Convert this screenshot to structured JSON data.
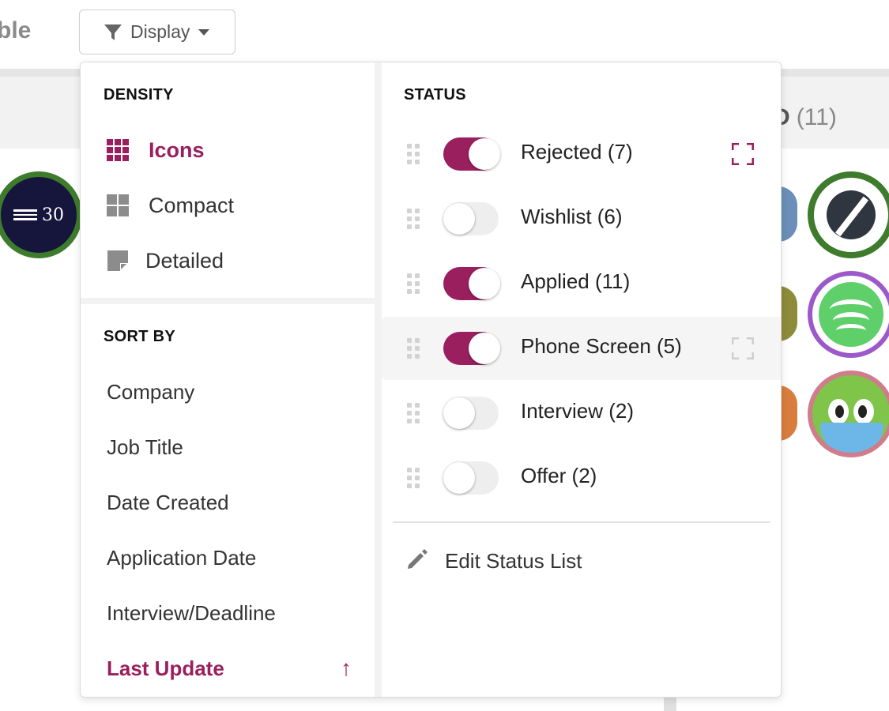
{
  "page": {
    "partial_title": "ble"
  },
  "toolbar": {
    "display_label": "Display"
  },
  "column": {
    "title_partial": "ED",
    "count": "(11)"
  },
  "logos": {
    "thirty_text": "30"
  },
  "colors": {
    "accent": "#9a1f5e",
    "toggle_off": "#eeeeee",
    "muted_icon": "#8c8c8c"
  },
  "density": {
    "heading": "DENSITY",
    "items": [
      {
        "label": "Icons",
        "icon": "grid-icon",
        "active": true
      },
      {
        "label": "Compact",
        "icon": "four-squares-icon",
        "active": false
      },
      {
        "label": "Detailed",
        "icon": "note-icon",
        "active": false
      }
    ]
  },
  "sort": {
    "heading": "SORT BY",
    "items": [
      {
        "label": "Company"
      },
      {
        "label": "Job Title"
      },
      {
        "label": "Date Created"
      },
      {
        "label": "Application Date"
      },
      {
        "label": "Interview/Deadline"
      },
      {
        "label": "Last Update",
        "active": true,
        "direction_icon": "arrow-up-icon",
        "direction_glyph": "↑"
      }
    ]
  },
  "status": {
    "heading": "STATUS",
    "items": [
      {
        "label": "Rejected (7)",
        "enabled": true,
        "expand_icon": true,
        "expand_active": true
      },
      {
        "label": "Wishlist (6)",
        "enabled": false
      },
      {
        "label": "Applied (11)",
        "enabled": true
      },
      {
        "label": "Phone Screen (5)",
        "enabled": true,
        "expand_icon": true,
        "expand_active": false,
        "hovered": true
      },
      {
        "label": "Interview (2)",
        "enabled": false
      },
      {
        "label": "Offer (2)",
        "enabled": false
      }
    ],
    "edit_label": "Edit Status List",
    "edit_icon": "pencil-icon"
  }
}
